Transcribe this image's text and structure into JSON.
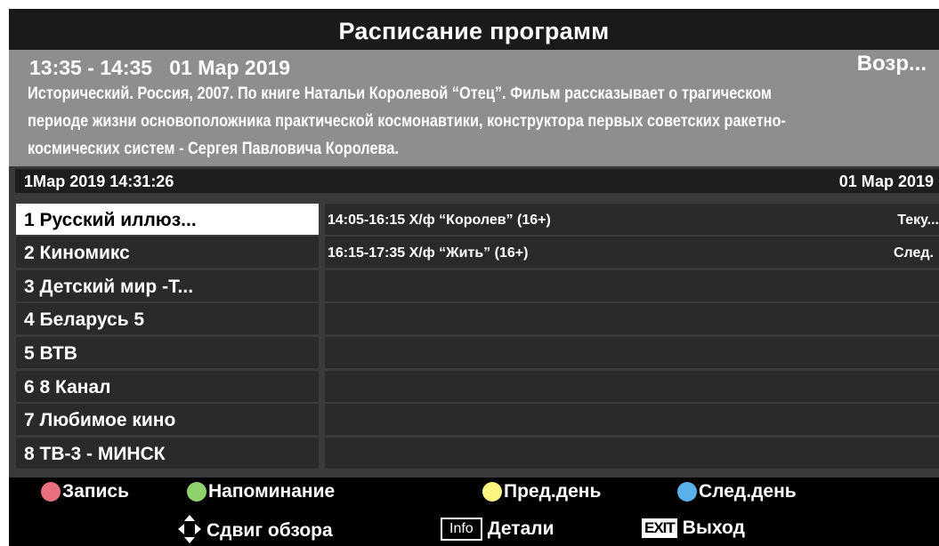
{
  "header": {
    "title": "Расписание программ"
  },
  "info": {
    "time_range": "13:35 - 14:35   01 Мар 2019",
    "rating": "Возр...",
    "description_line1": "Исторический. Россия, 2007. По книге Натальи Королевой “Отец”. Фильм рассказывает о трагическом",
    "description_line2": "периоде жизни основоположника практической космонавтики, конструктора первых советских ракетно-",
    "description_line3": "космических систем - Сергея Павловича Королева."
  },
  "date_bar": {
    "current_datetime": "1Мар 2019  14:31:26",
    "selected_date": "01 Мар 2019"
  },
  "channels": [
    {
      "label": "1 Русский иллюз...",
      "selected": true
    },
    {
      "label": "2 Киномикс"
    },
    {
      "label": "3 Детский мир -Т..."
    },
    {
      "label": "4 Беларусь 5"
    },
    {
      "label": "5 ВТВ"
    },
    {
      "label": "6 8 Канал"
    },
    {
      "label": "7 Любимое кино"
    },
    {
      "label": "8 ТВ-3 - МИНСК"
    }
  ],
  "events": [
    {
      "title": "14:05-16:15  Х/ф “Королев” (16+)",
      "status": "Теку..."
    },
    {
      "title": "16:15-17:35  Х/ф “Жить” (16+)",
      "status": "След."
    }
  ],
  "legend": {
    "record": "Запись",
    "reminder": "Напоминание",
    "prev_day": "Пред.день",
    "next_day": "След.день",
    "scroll": "Сдвиг обзора",
    "info_key": "Info",
    "details": "Детали",
    "exit_key": "EXIT",
    "exit": "Выход"
  },
  "colors": {
    "red": "#e8707c",
    "green": "#8fd16b",
    "yellow": "#fbf47e",
    "blue": "#5ab0e8"
  }
}
